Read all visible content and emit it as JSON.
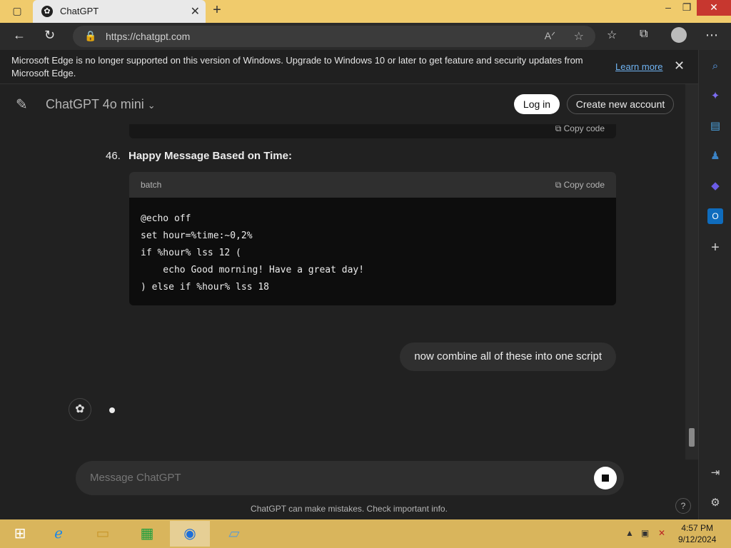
{
  "browser": {
    "tab_title": "ChatGPT",
    "url": "https://chatgpt.com",
    "banner_text": "Microsoft Edge is no longer supported on this version of Windows. Upgrade to Windows 10 or later to get feature and security updates from Microsoft Edge.",
    "banner_link": "Learn more"
  },
  "header": {
    "model_name": "ChatGPT 4o mini",
    "login_label": "Log in",
    "create_account_label": "Create new account"
  },
  "chat": {
    "prev_copy_label": "Copy code",
    "item_number": "46.",
    "item_title": "Happy Message Based on Time:",
    "code_lang": "batch",
    "code_copy_label": "Copy code",
    "code": "@echo off\nset hour=%time:~0,2%\nif %hour% lss 12 (\n    echo Good morning! Have a great day!\n) else if %hour% lss 18",
    "user_message": "now combine all of these into one script"
  },
  "composer": {
    "placeholder": "Message ChatGPT"
  },
  "footer": {
    "disclaimer": "ChatGPT can make mistakes. Check important info.",
    "help": "?"
  },
  "taskbar": {
    "time": "4:57 PM",
    "date": "9/12/2024"
  },
  "colors": {
    "titlebar": "#f0cb6c",
    "taskbar": "#d9b55c",
    "chat_bg": "#212121",
    "link": "#6fb3f2"
  },
  "icons": [
    "sidebar-toggle-icon",
    "chatgpt-favicon-icon",
    "close-icon",
    "new-tab-icon",
    "minimize-icon",
    "restore-icon",
    "window-close-icon",
    "back-icon",
    "refresh-icon",
    "lock-icon",
    "read-aloud-icon",
    "add-favorite-icon",
    "favorites-icon",
    "collections-icon",
    "profile-icon",
    "more-icon",
    "search-icon",
    "copilot-icon",
    "shopping-icon",
    "games-icon",
    "edge-copilot-icon",
    "outlook-icon",
    "add-icon",
    "split-screen-icon",
    "settings-icon",
    "edit-icon",
    "chevron-down-icon",
    "copy-icon",
    "openai-icon",
    "stop-icon",
    "windows-start-icon",
    "ie-icon",
    "file-explorer-icon",
    "store-icon",
    "edge-icon",
    "app-icon",
    "network-icon",
    "volume-icon"
  ]
}
